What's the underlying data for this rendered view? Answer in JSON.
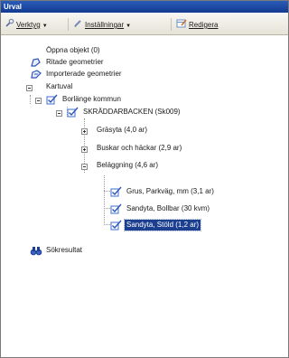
{
  "window": {
    "title": "Urval"
  },
  "toolbar": {
    "tools_label": "Verktyg",
    "settings_label": "Inställningar",
    "edit_label": "Redigera"
  },
  "tree": {
    "open_objects": "Öppna objekt (0)",
    "drawn_geometries": "Ritade geometrier",
    "imported_geometries": "Importerade geometrier",
    "map_selection": "Kartuval",
    "municipality": "Borlänge kommun",
    "area": "SKRÄDDARBACKEN (Sk009)",
    "grass": "Gräsyta (4,0 ar)",
    "bushes": "Buskar och häckar (2,9 ar)",
    "paving": "Beläggning (4,6 ar)",
    "gravel": "Grus, Parkväg, mm (3,1 ar)",
    "sand_ball": "Sandyta, Bollbar (30 kvm)",
    "sand_play": "Sandyta, Stöld (1,2 ar)",
    "search_results": "Sökresultat"
  },
  "colors": {
    "titlebar": "#1c4aa6",
    "selection": "#1c3f8f",
    "checkbox_accent": "#3c6fd0"
  }
}
